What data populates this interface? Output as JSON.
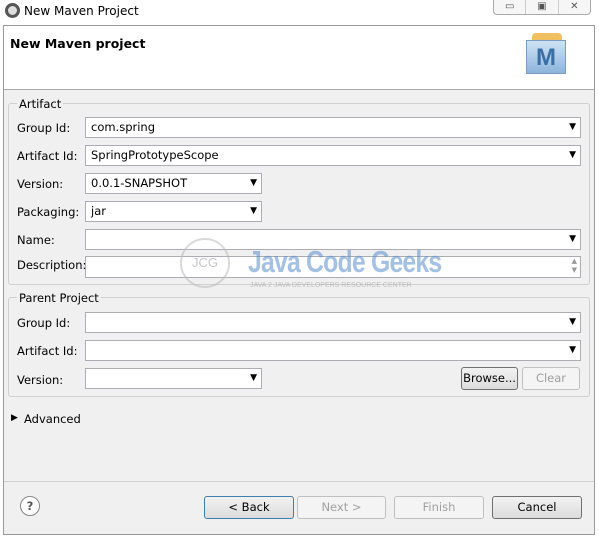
{
  "window": {
    "title": "New Maven Project",
    "controls": [
      "minimize",
      "maximize",
      "close"
    ]
  },
  "header": {
    "title": "New Maven project",
    "logo_letter": "M"
  },
  "artifact": {
    "label": "Artifact",
    "group_id": {
      "label": "Group Id:",
      "value": "com.spring"
    },
    "artifact_id": {
      "label": "Artifact Id:",
      "value": "SpringPrototypeScope"
    },
    "version": {
      "label": "Version:",
      "value": "0.0.1-SNAPSHOT"
    },
    "packaging": {
      "label": "Packaging:",
      "value": "jar"
    },
    "name": {
      "label": "Name:",
      "value": ""
    },
    "description": {
      "label": "Description:",
      "value": ""
    }
  },
  "parent": {
    "label": "Parent Project",
    "group_id": {
      "label": "Group Id:",
      "value": ""
    },
    "artifact_id": {
      "label": "Artifact Id:",
      "value": ""
    },
    "version": {
      "label": "Version:",
      "value": ""
    },
    "browse": "Browse...",
    "clear": "Clear"
  },
  "advanced": "Advanced",
  "watermark": {
    "title": "Java Code Geeks",
    "subtitle": "Java 2 Java Developers Resource Center",
    "badge": "JCG"
  },
  "footer": {
    "back": "< Back",
    "next": "Next >",
    "finish": "Finish",
    "cancel": "Cancel",
    "help": "?"
  }
}
